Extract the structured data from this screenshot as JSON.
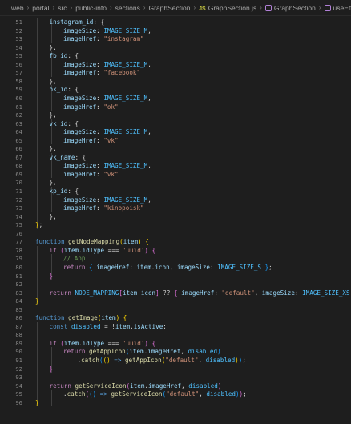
{
  "breadcrumb": {
    "items": [
      {
        "label": "web",
        "kind": "folder"
      },
      {
        "label": "portal",
        "kind": "folder"
      },
      {
        "label": "src",
        "kind": "folder"
      },
      {
        "label": "public-info",
        "kind": "folder"
      },
      {
        "label": "sections",
        "kind": "folder"
      },
      {
        "label": "GraphSection",
        "kind": "folder"
      },
      {
        "label": "GraphSection.js",
        "kind": "file",
        "badge": "JS"
      },
      {
        "label": "GraphSection",
        "kind": "symbol"
      },
      {
        "label": "useEffec",
        "kind": "symbol"
      }
    ]
  },
  "editor": {
    "cut_line_text": "",
    "lines": [
      {
        "n": "51",
        "indent": 1,
        "tokens": [
          [
            "p",
            "instagram_id"
          ],
          [
            "o",
            ": {"
          ]
        ]
      },
      {
        "n": "52",
        "indent": 2,
        "tokens": [
          [
            "p",
            "imageSize"
          ],
          [
            "o",
            ": "
          ],
          [
            "c",
            "IMAGE_SIZE_M"
          ],
          [
            "o",
            ","
          ]
        ]
      },
      {
        "n": "53",
        "indent": 2,
        "tokens": [
          [
            "p",
            "imageHref"
          ],
          [
            "o",
            ": "
          ],
          [
            "s",
            "\"instagram\""
          ]
        ]
      },
      {
        "n": "54",
        "indent": 1,
        "tokens": [
          [
            "o",
            "},"
          ]
        ]
      },
      {
        "n": "55",
        "indent": 1,
        "tokens": [
          [
            "p",
            "fb_id"
          ],
          [
            "o",
            ": {"
          ]
        ]
      },
      {
        "n": "56",
        "indent": 2,
        "tokens": [
          [
            "p",
            "imageSize"
          ],
          [
            "o",
            ": "
          ],
          [
            "c",
            "IMAGE_SIZE_M"
          ],
          [
            "o",
            ","
          ]
        ]
      },
      {
        "n": "57",
        "indent": 2,
        "tokens": [
          [
            "p",
            "imageHref"
          ],
          [
            "o",
            ": "
          ],
          [
            "s",
            "\"facebook\""
          ]
        ]
      },
      {
        "n": "58",
        "indent": 1,
        "tokens": [
          [
            "o",
            "},"
          ]
        ]
      },
      {
        "n": "59",
        "indent": 1,
        "tokens": [
          [
            "p",
            "ok_id"
          ],
          [
            "o",
            ": {"
          ]
        ]
      },
      {
        "n": "60",
        "indent": 2,
        "tokens": [
          [
            "p",
            "imageSize"
          ],
          [
            "o",
            ": "
          ],
          [
            "c",
            "IMAGE_SIZE_M"
          ],
          [
            "o",
            ","
          ]
        ]
      },
      {
        "n": "61",
        "indent": 2,
        "tokens": [
          [
            "p",
            "imageHref"
          ],
          [
            "o",
            ": "
          ],
          [
            "s",
            "\"ok\""
          ]
        ]
      },
      {
        "n": "62",
        "indent": 1,
        "tokens": [
          [
            "o",
            "},"
          ]
        ]
      },
      {
        "n": "63",
        "indent": 1,
        "tokens": [
          [
            "p",
            "vk_id"
          ],
          [
            "o",
            ": {"
          ]
        ]
      },
      {
        "n": "64",
        "indent": 2,
        "tokens": [
          [
            "p",
            "imageSize"
          ],
          [
            "o",
            ": "
          ],
          [
            "c",
            "IMAGE_SIZE_M"
          ],
          [
            "o",
            ","
          ]
        ]
      },
      {
        "n": "65",
        "indent": 2,
        "tokens": [
          [
            "p",
            "imageHref"
          ],
          [
            "o",
            ": "
          ],
          [
            "s",
            "\"vk\""
          ]
        ]
      },
      {
        "n": "66",
        "indent": 1,
        "tokens": [
          [
            "o",
            "},"
          ]
        ]
      },
      {
        "n": "67",
        "indent": 1,
        "tokens": [
          [
            "p",
            "vk_name"
          ],
          [
            "o",
            ": {"
          ]
        ]
      },
      {
        "n": "68",
        "indent": 2,
        "tokens": [
          [
            "p",
            "imageSize"
          ],
          [
            "o",
            ": "
          ],
          [
            "c",
            "IMAGE_SIZE_M"
          ],
          [
            "o",
            ","
          ]
        ]
      },
      {
        "n": "69",
        "indent": 2,
        "tokens": [
          [
            "p",
            "imageHref"
          ],
          [
            "o",
            ": "
          ],
          [
            "s",
            "\"vk\""
          ]
        ]
      },
      {
        "n": "70",
        "indent": 1,
        "tokens": [
          [
            "o",
            "},"
          ]
        ]
      },
      {
        "n": "71",
        "indent": 1,
        "tokens": [
          [
            "p",
            "kp_id"
          ],
          [
            "o",
            ": {"
          ]
        ]
      },
      {
        "n": "72",
        "indent": 2,
        "tokens": [
          [
            "p",
            "imageSize"
          ],
          [
            "o",
            ": "
          ],
          [
            "c",
            "IMAGE_SIZE_M"
          ],
          [
            "o",
            ","
          ]
        ]
      },
      {
        "n": "73",
        "indent": 2,
        "tokens": [
          [
            "p",
            "imageHref"
          ],
          [
            "o",
            ": "
          ],
          [
            "s",
            "\"kinopoisk\""
          ]
        ]
      },
      {
        "n": "74",
        "indent": 1,
        "tokens": [
          [
            "o",
            "},"
          ]
        ]
      },
      {
        "n": "75",
        "indent": 0,
        "tokens": [
          [
            "b1",
            "}"
          ],
          [
            "o",
            ";"
          ]
        ]
      },
      {
        "n": "76",
        "indent": 0,
        "tokens": []
      },
      {
        "n": "77",
        "indent": 0,
        "tokens": [
          [
            "k",
            "function "
          ],
          [
            "f",
            "getNodeMapping"
          ],
          [
            "b1",
            "("
          ],
          [
            "p",
            "item"
          ],
          [
            "b1",
            ")"
          ],
          [
            "o",
            " "
          ],
          [
            "b1",
            "{"
          ]
        ]
      },
      {
        "n": "78",
        "indent": 1,
        "tokens": [
          [
            "kc",
            "if "
          ],
          [
            "b2",
            "("
          ],
          [
            "p",
            "item"
          ],
          [
            "o",
            "."
          ],
          [
            "p",
            "idType"
          ],
          [
            "o",
            " === "
          ],
          [
            "s",
            "'uuid'"
          ],
          [
            "b2",
            ")"
          ],
          [
            "o",
            " "
          ],
          [
            "b2",
            "{"
          ]
        ]
      },
      {
        "n": "79",
        "indent": 2,
        "tokens": [
          [
            "cm",
            "// App"
          ]
        ]
      },
      {
        "n": "80",
        "indent": 2,
        "tokens": [
          [
            "kc",
            "return "
          ],
          [
            "b3",
            "{"
          ],
          [
            "o",
            " "
          ],
          [
            "p",
            "imageHref"
          ],
          [
            "o",
            ": "
          ],
          [
            "p",
            "item"
          ],
          [
            "o",
            "."
          ],
          [
            "p",
            "icon"
          ],
          [
            "o",
            ", "
          ],
          [
            "p",
            "imageSize"
          ],
          [
            "o",
            ": "
          ],
          [
            "c",
            "IMAGE_SIZE_S"
          ],
          [
            "o",
            " "
          ],
          [
            "b3",
            "}"
          ],
          [
            "o",
            ";"
          ]
        ]
      },
      {
        "n": "81",
        "indent": 1,
        "tokens": [
          [
            "b2",
            "}"
          ]
        ]
      },
      {
        "n": "82",
        "indent": 0,
        "tokens": []
      },
      {
        "n": "83",
        "indent": 1,
        "tokens": [
          [
            "kc",
            "return "
          ],
          [
            "c",
            "NODE_MAPPING"
          ],
          [
            "b2",
            "["
          ],
          [
            "p",
            "item"
          ],
          [
            "o",
            "."
          ],
          [
            "p",
            "icon"
          ],
          [
            "b2",
            "]"
          ],
          [
            "o",
            " ?? "
          ],
          [
            "b2",
            "{"
          ],
          [
            "o",
            " "
          ],
          [
            "p",
            "imageHref"
          ],
          [
            "o",
            ": "
          ],
          [
            "s",
            "\"default\""
          ],
          [
            "o",
            ", "
          ],
          [
            "p",
            "imageSize"
          ],
          [
            "o",
            ": "
          ],
          [
            "c",
            "IMAGE_SIZE_XS"
          ],
          [
            "o",
            " "
          ],
          [
            "b2",
            "}"
          ],
          [
            "o",
            ";"
          ]
        ]
      },
      {
        "n": "84",
        "indent": 0,
        "tokens": [
          [
            "b1",
            "}"
          ]
        ]
      },
      {
        "n": "85",
        "indent": 0,
        "tokens": []
      },
      {
        "n": "86",
        "indent": 0,
        "tokens": [
          [
            "k",
            "function "
          ],
          [
            "f",
            "getImage"
          ],
          [
            "b1",
            "("
          ],
          [
            "p",
            "item"
          ],
          [
            "b1",
            ")"
          ],
          [
            "o",
            " "
          ],
          [
            "b1",
            "{"
          ]
        ]
      },
      {
        "n": "87",
        "indent": 1,
        "tokens": [
          [
            "k",
            "const "
          ],
          [
            "c",
            "disabled"
          ],
          [
            "o",
            " = !"
          ],
          [
            "p",
            "item"
          ],
          [
            "o",
            "."
          ],
          [
            "p",
            "isActive"
          ],
          [
            "o",
            ";"
          ]
        ]
      },
      {
        "n": "88",
        "indent": 0,
        "tokens": []
      },
      {
        "n": "89",
        "indent": 1,
        "tokens": [
          [
            "kc",
            "if "
          ],
          [
            "b2",
            "("
          ],
          [
            "p",
            "item"
          ],
          [
            "o",
            "."
          ],
          [
            "p",
            "idType"
          ],
          [
            "o",
            " === "
          ],
          [
            "s",
            "'uuid'"
          ],
          [
            "b2",
            ")"
          ],
          [
            "o",
            " "
          ],
          [
            "b2",
            "{"
          ]
        ]
      },
      {
        "n": "90",
        "indent": 2,
        "tokens": [
          [
            "kc",
            "return "
          ],
          [
            "f",
            "getAppIcon"
          ],
          [
            "b3",
            "("
          ],
          [
            "p",
            "item"
          ],
          [
            "o",
            "."
          ],
          [
            "p",
            "imageHref"
          ],
          [
            "o",
            ", "
          ],
          [
            "c",
            "disabled"
          ],
          [
            "b3",
            ")"
          ]
        ]
      },
      {
        "n": "91",
        "indent": 3,
        "tokens": [
          [
            "o",
            "."
          ],
          [
            "f",
            "catch"
          ],
          [
            "b3",
            "("
          ],
          [
            "b1",
            "()"
          ],
          [
            "o",
            " "
          ],
          [
            "k",
            "=>"
          ],
          [
            "o",
            " "
          ],
          [
            "f",
            "getAppIcon"
          ],
          [
            "b1",
            "("
          ],
          [
            "s",
            "\"default\""
          ],
          [
            "o",
            ", "
          ],
          [
            "c",
            "disabled"
          ],
          [
            "b1",
            ")"
          ],
          [
            "b3",
            ")"
          ],
          [
            "o",
            ";"
          ]
        ]
      },
      {
        "n": "92",
        "indent": 1,
        "tokens": [
          [
            "b2",
            "}"
          ]
        ]
      },
      {
        "n": "93",
        "indent": 0,
        "tokens": []
      },
      {
        "n": "94",
        "indent": 1,
        "tokens": [
          [
            "kc",
            "return "
          ],
          [
            "f",
            "getServiceIcon"
          ],
          [
            "b2",
            "("
          ],
          [
            "p",
            "item"
          ],
          [
            "o",
            "."
          ],
          [
            "p",
            "imageHref"
          ],
          [
            "o",
            ", "
          ],
          [
            "c",
            "disabled"
          ],
          [
            "b2",
            ")"
          ]
        ]
      },
      {
        "n": "95",
        "indent": 2,
        "tokens": [
          [
            "o",
            "."
          ],
          [
            "f",
            "catch"
          ],
          [
            "b2",
            "("
          ],
          [
            "b3",
            "()"
          ],
          [
            "o",
            " "
          ],
          [
            "k",
            "=>"
          ],
          [
            "o",
            " "
          ],
          [
            "f",
            "getServiceIcon"
          ],
          [
            "b3",
            "("
          ],
          [
            "s",
            "\"default\""
          ],
          [
            "o",
            ", "
          ],
          [
            "c",
            "disabled"
          ],
          [
            "b3",
            ")"
          ],
          [
            "b2",
            ")"
          ],
          [
            "o",
            ";"
          ]
        ]
      },
      {
        "n": "96",
        "indent": 0,
        "tokens": [
          [
            "b1",
            "}"
          ]
        ]
      }
    ]
  },
  "colors": {
    "background": "#1e1e1e",
    "keyword": "#569cd6",
    "control": "#c586c0",
    "function": "#dcdcaa",
    "property": "#9cdcfe",
    "string": "#ce9178",
    "constant": "#4fc1ff",
    "comment": "#6a9955",
    "line_number": "#858585"
  }
}
